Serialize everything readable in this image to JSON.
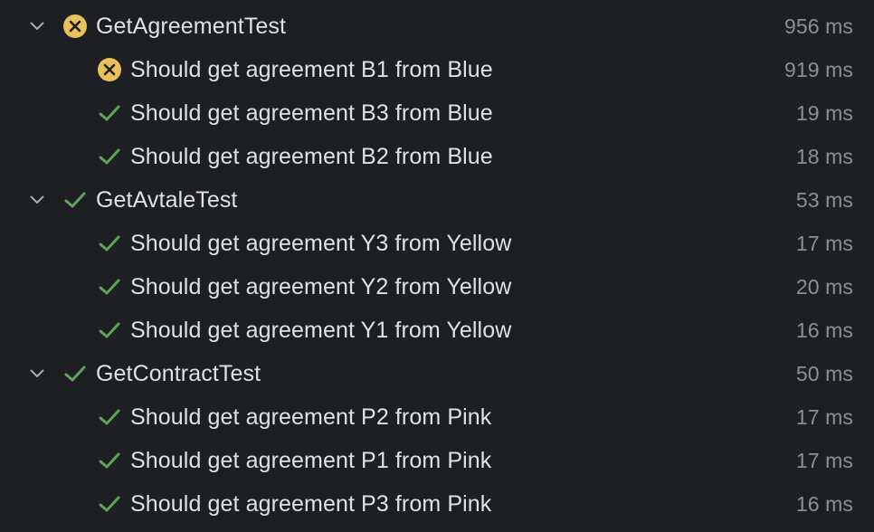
{
  "colors": {
    "background": "#1e1f22",
    "text": "#dfe1e5",
    "duration": "#8c8f94",
    "pass": "#5fa35f",
    "fail": "#e8c15a",
    "chevron": "#a8abb0"
  },
  "groups": [
    {
      "name": "GetAgreementTest",
      "status": "failed",
      "icon": "fail-icon",
      "duration": "956 ms",
      "expanded": true,
      "tests": [
        {
          "name": "Should get agreement B1 from Blue",
          "status": "failed",
          "icon": "fail-icon",
          "duration": "919 ms"
        },
        {
          "name": "Should get agreement B3 from Blue",
          "status": "passed",
          "icon": "check-icon",
          "duration": "19 ms"
        },
        {
          "name": "Should get agreement B2 from Blue",
          "status": "passed",
          "icon": "check-icon",
          "duration": "18 ms"
        }
      ]
    },
    {
      "name": "GetAvtaleTest",
      "status": "passed",
      "icon": "check-icon",
      "duration": "53 ms",
      "expanded": true,
      "tests": [
        {
          "name": "Should get agreement Y3 from Yellow",
          "status": "passed",
          "icon": "check-icon",
          "duration": "17 ms"
        },
        {
          "name": "Should get agreement Y2 from Yellow",
          "status": "passed",
          "icon": "check-icon",
          "duration": "20 ms"
        },
        {
          "name": "Should get agreement Y1 from Yellow",
          "status": "passed",
          "icon": "check-icon",
          "duration": "16 ms"
        }
      ]
    },
    {
      "name": "GetContractTest",
      "status": "passed",
      "icon": "check-icon",
      "duration": "50 ms",
      "expanded": true,
      "tests": [
        {
          "name": "Should get agreement P2 from Pink",
          "status": "passed",
          "icon": "check-icon",
          "duration": "17 ms"
        },
        {
          "name": "Should get agreement P1 from Pink",
          "status": "passed",
          "icon": "check-icon",
          "duration": "17 ms"
        },
        {
          "name": "Should get agreement P3 from Pink",
          "status": "passed",
          "icon": "check-icon",
          "duration": "16 ms"
        }
      ]
    }
  ]
}
